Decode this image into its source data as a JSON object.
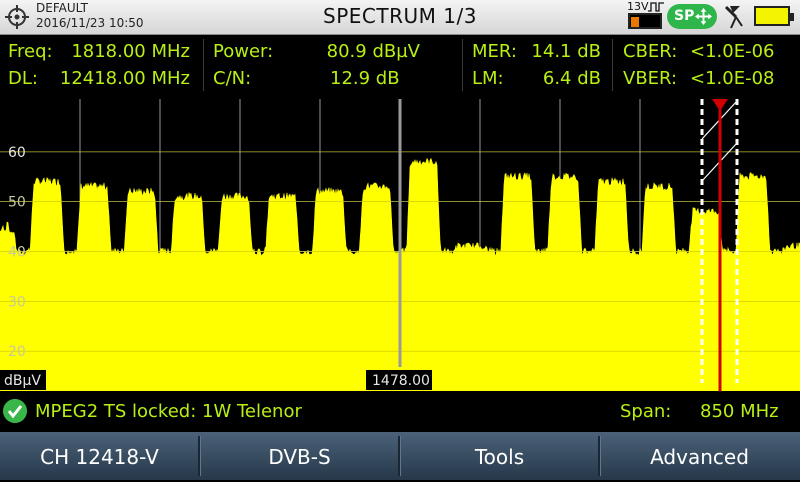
{
  "header": {
    "profile_name": "DEFAULT",
    "datetime": "2016/11/23 10:50",
    "title": "SPECTRUM 1/3",
    "lnb_voltage": "13V",
    "sp_label": "SP",
    "battery_level": 1.0
  },
  "measurements": {
    "freq_label": "Freq:",
    "freq_value": "1818.00 MHz",
    "dl_label": "DL:",
    "dl_value": "12418.00 MHz",
    "power_label": "Power:",
    "power_value": "80.9 dBµV",
    "cn_label": "C/N:",
    "cn_value": "12.9 dB",
    "mer_label": "MER:",
    "mer_value": "14.1 dB",
    "lm_label": "LM:",
    "lm_value": "6.4 dB",
    "cber_label": "CBER:",
    "cber_value": "<1.0E-06",
    "vber_label": "VBER:",
    "vber_value": "<1.0E-08"
  },
  "chart_data": {
    "type": "area",
    "unit_label": "dBµV",
    "y_ticks": [
      20,
      30,
      40,
      50,
      60
    ],
    "ylim": [
      12,
      71
    ],
    "center_frequency_label": "1478.00",
    "span": "850 MHz",
    "grid": true,
    "x_frequency_mhz": [
      1053,
      1103,
      1153,
      1203,
      1253,
      1303,
      1353,
      1403,
      1453,
      1503,
      1553,
      1603,
      1653,
      1703,
      1753,
      1803,
      1853,
      1903
    ],
    "y_level_dbuv": [
      44,
      54,
      53,
      52,
      51,
      51,
      51,
      52,
      53,
      58,
      41,
      55,
      55,
      54,
      53,
      48,
      55,
      41
    ],
    "marker_frequency_mhz": 1818,
    "colors": {
      "fill": "#ffff00",
      "marker": "#d00000",
      "grid": "#ffffff",
      "center": "#9a9a9a"
    }
  },
  "status": {
    "lock_message": "MPEG2 TS locked: 1W Telenor",
    "span_label": "Span:",
    "span_value": "850 MHz"
  },
  "softkeys": [
    "CH 12418-V",
    "DVB-S",
    "Tools",
    "Advanced"
  ]
}
